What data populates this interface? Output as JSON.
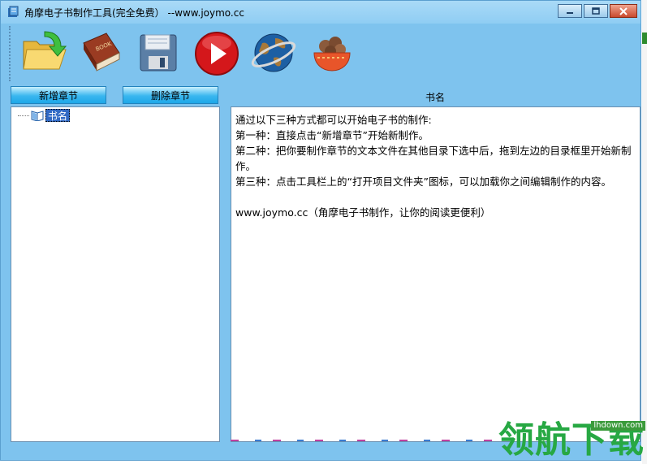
{
  "window": {
    "title": "角摩电子书制作工具(完全免费） --www.joymo.cc"
  },
  "toolbar": {
    "items": [
      {
        "icon": "open-folder-icon"
      },
      {
        "icon": "book-icon"
      },
      {
        "icon": "save-disk-icon"
      },
      {
        "icon": "play-icon"
      },
      {
        "icon": "globe-icon"
      },
      {
        "icon": "food-bowl-icon"
      }
    ]
  },
  "chapters": {
    "add_label": "新增章节",
    "delete_label": "删除章节"
  },
  "tree": {
    "root_label": "书名"
  },
  "content": {
    "heading": "书名",
    "lines": [
      "通过以下三种方式都可以开始电子书的制作:",
      "第一种：直接点击“新增章节”开始新制作。",
      "第二种：把你要制作章节的文本文件在其他目录下选中后，拖到左边的目录框里开始新制作。",
      "第三种：点击工具栏上的“打开项目文件夹”图标，可以加载你之间编辑制作的内容。",
      "",
      "www.joymo.cc（角摩电子书制作，让你的阅读更便利）"
    ]
  },
  "watermark": {
    "text": "领航下载",
    "url": "lhdown.com"
  },
  "colors": {
    "window_bg": "#7ec3ee",
    "button_blue": "#1da7e8",
    "selection": "#316ac5",
    "watermark_green": "#27a843"
  }
}
